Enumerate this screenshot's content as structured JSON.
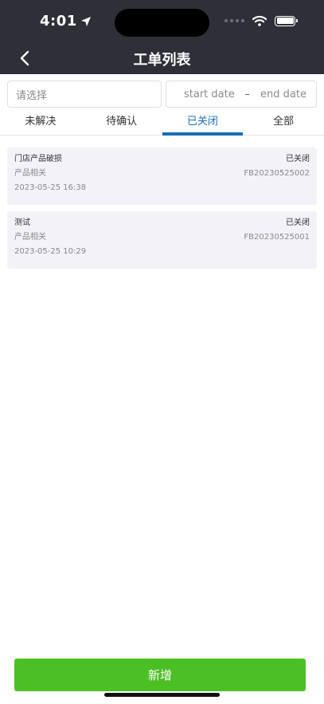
{
  "status_bar": {
    "time": "4:01"
  },
  "header": {
    "title": "工单列表"
  },
  "filters": {
    "select_placeholder": "请选择",
    "start_date": "start date",
    "separator": "–",
    "end_date": "end date"
  },
  "tabs": [
    {
      "label": "未解决",
      "active": false
    },
    {
      "label": "待确认",
      "active": false
    },
    {
      "label": "已关闭",
      "active": true
    },
    {
      "label": "全部",
      "active": false
    }
  ],
  "orders": [
    {
      "title": "门店产品破损",
      "status": "已关闭",
      "category": "产品相关",
      "number": "FB20230525002",
      "time": "2023-05-25 16:38"
    },
    {
      "title": "测试",
      "status": "已关闭",
      "category": "产品相关",
      "number": "FB20230525001",
      "time": "2023-05-25 10:29"
    }
  ],
  "footer": {
    "add_label": "新增"
  },
  "colors": {
    "header_bg": "#2f2f37",
    "active_tab": "#1b6fb2",
    "add_button": "#4cbf25",
    "card_bg": "#f2f2f8"
  }
}
